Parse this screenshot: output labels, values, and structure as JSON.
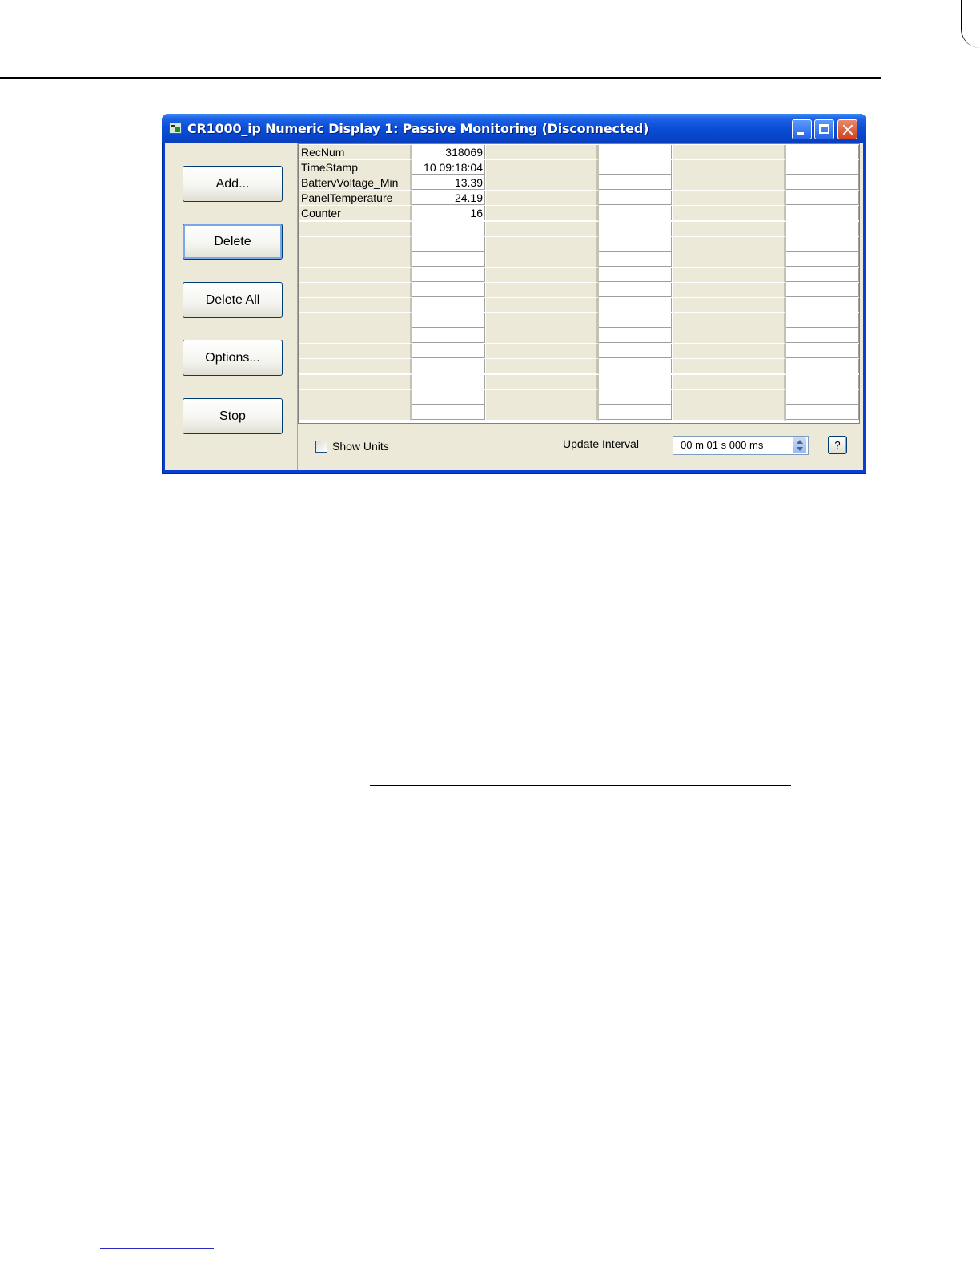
{
  "window": {
    "title": "CR1000_ip Numeric Display 1: Passive Monitoring (Disconnected)",
    "buttons": {
      "add": "Add...",
      "delete": "Delete",
      "delete_all": "Delete All",
      "options": "Options...",
      "stop": "Stop"
    },
    "grid": {
      "rows": [
        {
          "name": "RecNum",
          "value": "318069"
        },
        {
          "name": "TimeStamp",
          "value": "10 09:18:04"
        },
        {
          "name": "BattervVoltage_Min",
          "value": "13.39"
        },
        {
          "name": "PanelTemperature",
          "value": "24.19"
        },
        {
          "name": "Counter",
          "value": "16"
        }
      ],
      "total_rows": 18,
      "column_groups": 3
    },
    "bottom": {
      "show_units_label": "Show Units",
      "show_units_checked": false,
      "update_interval_label": "Update Interval",
      "update_interval_value": "00 m 01 s 000 ms",
      "help_label": "?"
    }
  }
}
